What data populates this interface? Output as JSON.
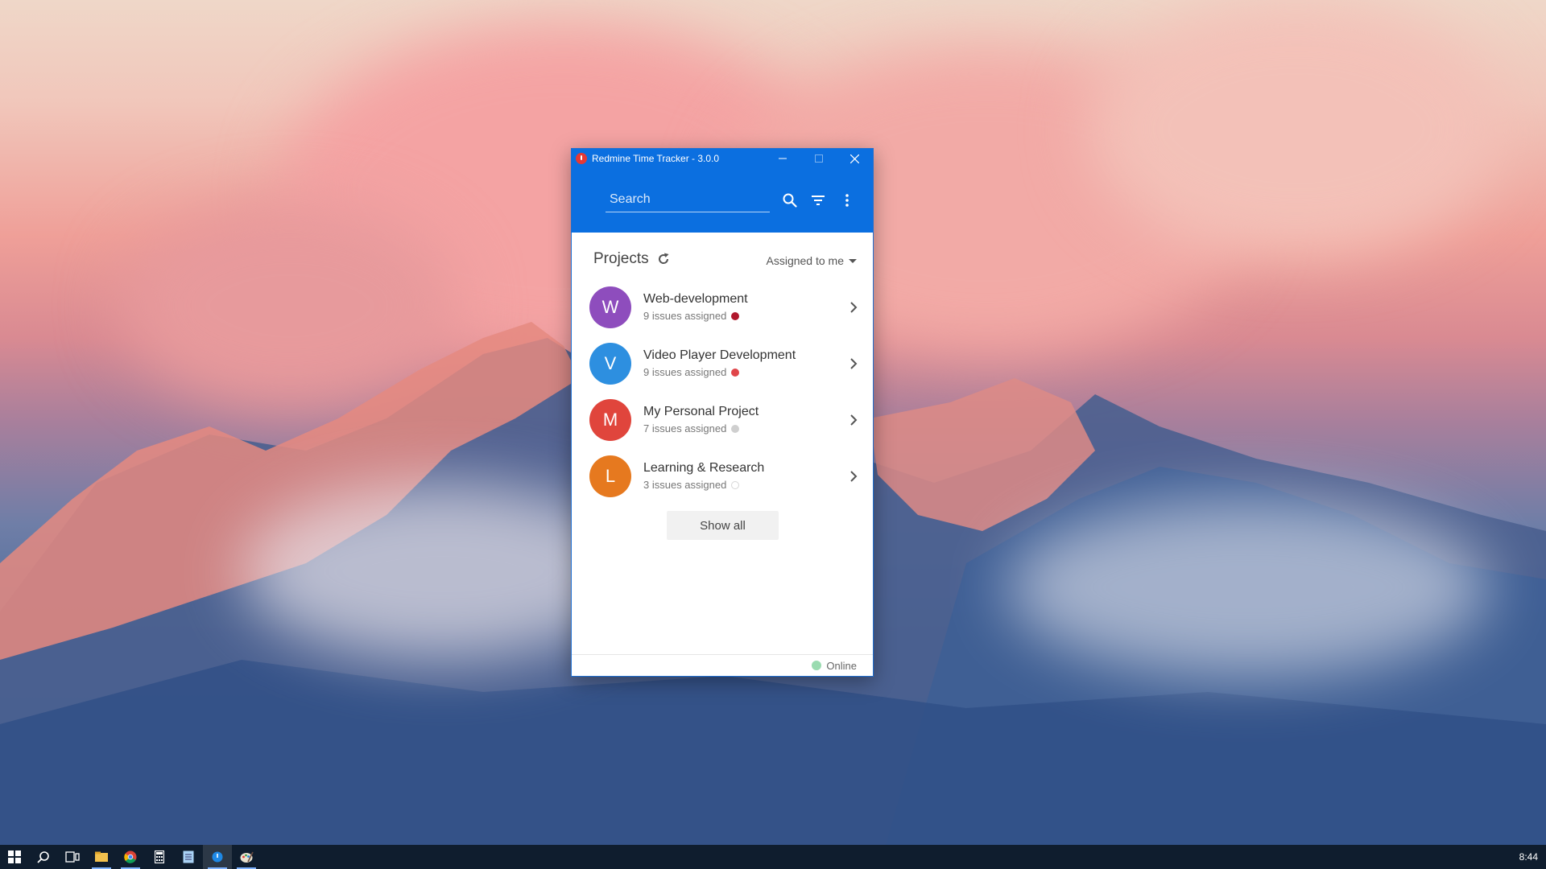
{
  "window": {
    "title": "Redmine Time Tracker - 3.0.0",
    "accent": "#0b6fe0"
  },
  "search": {
    "placeholder": "Search",
    "value": ""
  },
  "projects": {
    "title": "Projects",
    "filter_label": "Assigned to me",
    "items": [
      {
        "initial": "W",
        "name": "Web-development",
        "subtitle": "9 issues assigned",
        "avatar_color": "#8e4dbd",
        "dot_color": "#b0182d",
        "dot_style": "filled"
      },
      {
        "initial": "V",
        "name": "Video Player Development",
        "subtitle": "9 issues assigned",
        "avatar_color": "#2d8fe0",
        "dot_color": "#e0464a",
        "dot_style": "filled"
      },
      {
        "initial": "M",
        "name": "My Personal Project",
        "subtitle": "7 issues assigned",
        "avatar_color": "#e0453c",
        "dot_color": "#cfcfcf",
        "dot_style": "filled"
      },
      {
        "initial": "L",
        "name": "Learning & Research",
        "subtitle": "3 issues assigned",
        "avatar_color": "#e6791f",
        "dot_color": "#d6d6d6",
        "dot_style": "outline"
      }
    ],
    "show_all_label": "Show all"
  },
  "status": {
    "label": "Online",
    "dot_color": "#9adbb0"
  },
  "taskbar": {
    "icons": [
      "windows-start-icon",
      "search-icon",
      "task-view-icon",
      "file-explorer-icon",
      "chrome-icon",
      "calculator-icon",
      "notepad-icon",
      "redmine-tracker-icon",
      "paint-icon"
    ],
    "clock": "8:44"
  }
}
